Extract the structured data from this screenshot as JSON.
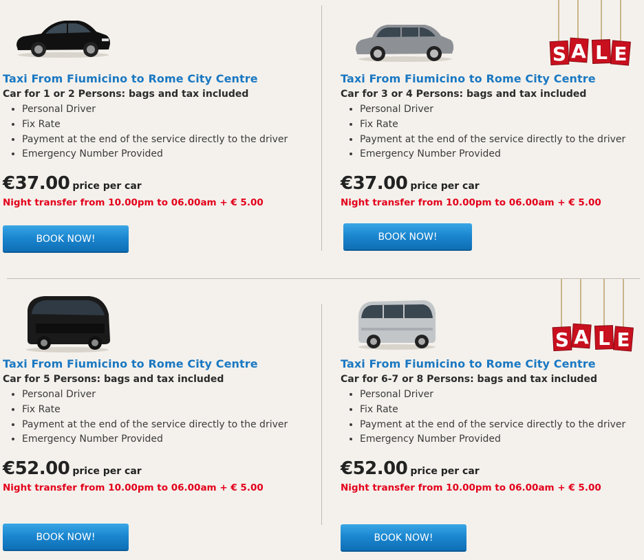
{
  "colors": {
    "title": "#1a78c2",
    "night": "#e3001b",
    "button": "#1a86cf",
    "sale": "#c8101e",
    "background": "#f4f1ec"
  },
  "cards": [
    {
      "vehicle_icon": "sedan-car-icon",
      "title": "Taxi From Fiumicino to Rome City Centre",
      "subtitle": "Car for 1 or 2 Persons: bags and tax included",
      "features": [
        "Personal Driver",
        "Fix Rate",
        "Payment at the end of the service directly to the driver",
        "Emergency Number Provided"
      ],
      "price": "€37.00",
      "price_suffix": "price per car",
      "night": "Night transfer from 10.00pm to 06.00am + € 5.00",
      "button": "BOOK NOW!",
      "sale": false
    },
    {
      "vehicle_icon": "station-wagon-car-icon",
      "title": "Taxi From Fiumicino to Rome City Centre",
      "subtitle": "Car for 3 or 4 Persons: bags and tax included",
      "features": [
        "Personal Driver",
        "Fix Rate",
        "Payment at the end of the service directly to the driver",
        "Emergency Number Provided"
      ],
      "price": "€37.00",
      "price_suffix": "price per car",
      "night": "Night transfer from 10.00pm to 06.00am + € 5.00",
      "button": "BOOK NOW!",
      "sale": true,
      "sale_text": "SALE"
    },
    {
      "vehicle_icon": "minivan-icon",
      "title": "Taxi From Fiumicino to Rome City Centre",
      "subtitle": "Car for 5 Persons: bags and tax  included",
      "features": [
        "Personal Driver",
        "Fix Rate",
        "Payment at the end of the service directly to the driver",
        "Emergency Number Provided"
      ],
      "price": "€52.00",
      "price_suffix": "price per car",
      "night": "Night transfer from 10.00pm to 06.00am + € 5.00",
      "button": "BOOK NOW!",
      "sale": false
    },
    {
      "vehicle_icon": "minibus-icon",
      "title": "Taxi From Fiumicino to Rome City Centre",
      "subtitle": "Car for 6-7 or 8 Persons: bags and tax included",
      "features": [
        "Personal Driver",
        "Fix Rate",
        "Payment at the end of the service directly to the driver",
        "Emergency Number Provided"
      ],
      "price": "€52.00",
      "price_suffix": "price per car",
      "night": "Night transfer from 10.00pm to 06.00am + € 5.00",
      "button": "BOOK NOW!",
      "sale": true,
      "sale_text": "SALE"
    }
  ]
}
